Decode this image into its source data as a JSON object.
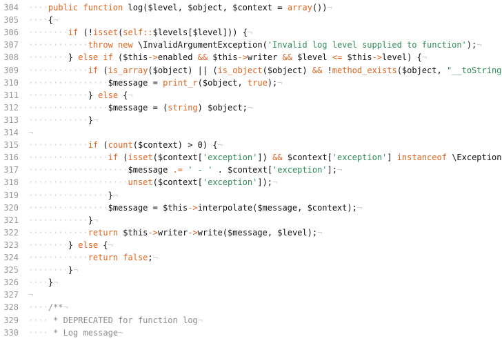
{
  "editor": {
    "colors": {
      "keyword": "#e0631e",
      "string": "#2e8b57",
      "comment": "#8c8c8c",
      "whitespace": "#d0d0d0",
      "line_number": "#999999",
      "text": "#111111"
    },
    "lines": [
      {
        "n": "304",
        "tokens": [
          {
            "t": "ws",
            "v": "····"
          },
          {
            "t": "kw",
            "v": "public function "
          },
          {
            "t": "plain",
            "v": "log($level, $object, $context = "
          },
          {
            "t": "kw",
            "v": "array"
          },
          {
            "t": "plain",
            "v": "())"
          },
          {
            "t": "eol",
            "v": "¬"
          }
        ]
      },
      {
        "n": "305",
        "tokens": [
          {
            "t": "ws",
            "v": "····"
          },
          {
            "t": "plain",
            "v": "{"
          },
          {
            "t": "eol",
            "v": "¬"
          }
        ]
      },
      {
        "n": "306",
        "tokens": [
          {
            "t": "ws",
            "v": "········"
          },
          {
            "t": "kw",
            "v": "if "
          },
          {
            "t": "plain",
            "v": "(!"
          },
          {
            "t": "kw",
            "v": "isset"
          },
          {
            "t": "plain",
            "v": "("
          },
          {
            "t": "kw",
            "v": "self::"
          },
          {
            "t": "plain",
            "v": "$levels[$level])) {"
          },
          {
            "t": "eol",
            "v": "¬"
          }
        ]
      },
      {
        "n": "307",
        "tokens": [
          {
            "t": "ws",
            "v": "············"
          },
          {
            "t": "kw",
            "v": "throw new "
          },
          {
            "t": "plain",
            "v": "\\InvalidArgumentException("
          },
          {
            "t": "str",
            "v": "'Invalid log level supplied to function'"
          },
          {
            "t": "plain",
            "v": ");"
          },
          {
            "t": "eol",
            "v": "¬"
          }
        ]
      },
      {
        "n": "308",
        "tokens": [
          {
            "t": "ws",
            "v": "········"
          },
          {
            "t": "plain",
            "v": "} "
          },
          {
            "t": "kw",
            "v": "else if "
          },
          {
            "t": "plain",
            "v": "($this"
          },
          {
            "t": "op",
            "v": "->"
          },
          {
            "t": "plain",
            "v": "enabled "
          },
          {
            "t": "op",
            "v": "&&"
          },
          {
            "t": "plain",
            "v": " $this"
          },
          {
            "t": "op",
            "v": "->"
          },
          {
            "t": "plain",
            "v": "writer "
          },
          {
            "t": "op",
            "v": "&&"
          },
          {
            "t": "plain",
            "v": " $level "
          },
          {
            "t": "op",
            "v": "<="
          },
          {
            "t": "plain",
            "v": " $this"
          },
          {
            "t": "op",
            "v": "->"
          },
          {
            "t": "plain",
            "v": "level) {"
          },
          {
            "t": "eol",
            "v": "¬"
          }
        ]
      },
      {
        "n": "309",
        "tokens": [
          {
            "t": "ws",
            "v": "············"
          },
          {
            "t": "kw",
            "v": "if "
          },
          {
            "t": "plain",
            "v": "("
          },
          {
            "t": "kw",
            "v": "is_array"
          },
          {
            "t": "plain",
            "v": "($object) || ("
          },
          {
            "t": "kw",
            "v": "is_object"
          },
          {
            "t": "plain",
            "v": "($object) "
          },
          {
            "t": "op",
            "v": "&&"
          },
          {
            "t": "plain",
            "v": " !"
          },
          {
            "t": "kw",
            "v": "method_exists"
          },
          {
            "t": "plain",
            "v": "($object, "
          },
          {
            "t": "str",
            "v": "\"__toString\""
          },
          {
            "t": "plain",
            "v": "))"
          }
        ]
      },
      {
        "n": "310",
        "tokens": [
          {
            "t": "ws",
            "v": "················"
          },
          {
            "t": "plain",
            "v": "$message = "
          },
          {
            "t": "kw",
            "v": "print_r"
          },
          {
            "t": "plain",
            "v": "($object, "
          },
          {
            "t": "kw",
            "v": "true"
          },
          {
            "t": "plain",
            "v": ");"
          },
          {
            "t": "eol",
            "v": "¬"
          }
        ]
      },
      {
        "n": "311",
        "tokens": [
          {
            "t": "ws",
            "v": "············"
          },
          {
            "t": "plain",
            "v": "} "
          },
          {
            "t": "kw",
            "v": "else "
          },
          {
            "t": "plain",
            "v": "{"
          },
          {
            "t": "eol",
            "v": "¬"
          }
        ]
      },
      {
        "n": "312",
        "tokens": [
          {
            "t": "ws",
            "v": "················"
          },
          {
            "t": "plain",
            "v": "$message = ("
          },
          {
            "t": "kw",
            "v": "string"
          },
          {
            "t": "plain",
            "v": ") $object;"
          },
          {
            "t": "eol",
            "v": "¬"
          }
        ]
      },
      {
        "n": "313",
        "tokens": [
          {
            "t": "ws",
            "v": "············"
          },
          {
            "t": "plain",
            "v": "}"
          },
          {
            "t": "eol",
            "v": "¬"
          }
        ]
      },
      {
        "n": "314",
        "tokens": [
          {
            "t": "eol",
            "v": "¬"
          }
        ]
      },
      {
        "n": "315",
        "tokens": [
          {
            "t": "ws",
            "v": "············"
          },
          {
            "t": "kw",
            "v": "if "
          },
          {
            "t": "plain",
            "v": "("
          },
          {
            "t": "kw",
            "v": "count"
          },
          {
            "t": "plain",
            "v": "($context) > 0) {"
          },
          {
            "t": "eol",
            "v": "¬"
          }
        ]
      },
      {
        "n": "316",
        "tokens": [
          {
            "t": "ws",
            "v": "················"
          },
          {
            "t": "kw",
            "v": "if "
          },
          {
            "t": "plain",
            "v": "("
          },
          {
            "t": "kw",
            "v": "isset"
          },
          {
            "t": "plain",
            "v": "($context["
          },
          {
            "t": "str",
            "v": "'exception'"
          },
          {
            "t": "plain",
            "v": "]) "
          },
          {
            "t": "op",
            "v": "&&"
          },
          {
            "t": "plain",
            "v": " $context["
          },
          {
            "t": "str",
            "v": "'exception'"
          },
          {
            "t": "plain",
            "v": "] "
          },
          {
            "t": "kw",
            "v": "instanceof "
          },
          {
            "t": "plain",
            "v": "\\Exception) {"
          }
        ]
      },
      {
        "n": "317",
        "tokens": [
          {
            "t": "ws",
            "v": "····················"
          },
          {
            "t": "plain",
            "v": "$message "
          },
          {
            "t": "op",
            "v": ".="
          },
          {
            "t": "plain",
            "v": " "
          },
          {
            "t": "str",
            "v": "' - '"
          },
          {
            "t": "plain",
            "v": " . $context["
          },
          {
            "t": "str",
            "v": "'exception'"
          },
          {
            "t": "plain",
            "v": "];"
          },
          {
            "t": "eol",
            "v": "¬"
          }
        ]
      },
      {
        "n": "318",
        "tokens": [
          {
            "t": "ws",
            "v": "····················"
          },
          {
            "t": "kw",
            "v": "unset"
          },
          {
            "t": "plain",
            "v": "($context["
          },
          {
            "t": "str",
            "v": "'exception'"
          },
          {
            "t": "plain",
            "v": "]);"
          },
          {
            "t": "eol",
            "v": "¬"
          }
        ]
      },
      {
        "n": "319",
        "tokens": [
          {
            "t": "ws",
            "v": "················"
          },
          {
            "t": "plain",
            "v": "}"
          },
          {
            "t": "eol",
            "v": "¬"
          }
        ]
      },
      {
        "n": "320",
        "tokens": [
          {
            "t": "ws",
            "v": "················"
          },
          {
            "t": "plain",
            "v": "$message = $this"
          },
          {
            "t": "op",
            "v": "->"
          },
          {
            "t": "plain",
            "v": "interpolate($message, $context);"
          },
          {
            "t": "eol",
            "v": "¬"
          }
        ]
      },
      {
        "n": "321",
        "tokens": [
          {
            "t": "ws",
            "v": "············"
          },
          {
            "t": "plain",
            "v": "}"
          },
          {
            "t": "eol",
            "v": "¬"
          }
        ]
      },
      {
        "n": "322",
        "tokens": [
          {
            "t": "ws",
            "v": "············"
          },
          {
            "t": "kw",
            "v": "return "
          },
          {
            "t": "plain",
            "v": "$this"
          },
          {
            "t": "op",
            "v": "->"
          },
          {
            "t": "plain",
            "v": "writer"
          },
          {
            "t": "op",
            "v": "->"
          },
          {
            "t": "plain",
            "v": "write($message, $level);"
          },
          {
            "t": "eol",
            "v": "¬"
          }
        ]
      },
      {
        "n": "323",
        "tokens": [
          {
            "t": "ws",
            "v": "········"
          },
          {
            "t": "plain",
            "v": "} "
          },
          {
            "t": "kw",
            "v": "else "
          },
          {
            "t": "plain",
            "v": "{"
          },
          {
            "t": "eol",
            "v": "¬"
          }
        ]
      },
      {
        "n": "324",
        "tokens": [
          {
            "t": "ws",
            "v": "············"
          },
          {
            "t": "kw",
            "v": "return false"
          },
          {
            "t": "plain",
            "v": ";"
          },
          {
            "t": "eol",
            "v": "¬"
          }
        ]
      },
      {
        "n": "325",
        "tokens": [
          {
            "t": "ws",
            "v": "········"
          },
          {
            "t": "plain",
            "v": "}"
          },
          {
            "t": "eol",
            "v": "¬"
          }
        ]
      },
      {
        "n": "326",
        "tokens": [
          {
            "t": "ws",
            "v": "····"
          },
          {
            "t": "plain",
            "v": "}"
          },
          {
            "t": "eol",
            "v": "¬"
          }
        ]
      },
      {
        "n": "327",
        "tokens": [
          {
            "t": "eol",
            "v": "¬"
          }
        ]
      },
      {
        "n": "328",
        "tokens": [
          {
            "t": "ws",
            "v": "····"
          },
          {
            "t": "cmt",
            "v": "/**"
          },
          {
            "t": "eol",
            "v": "¬"
          }
        ]
      },
      {
        "n": "329",
        "tokens": [
          {
            "t": "ws",
            "v": "····"
          },
          {
            "t": "cmt",
            "v": " * DEPRECATED for function log"
          },
          {
            "t": "eol",
            "v": "¬"
          }
        ]
      },
      {
        "n": "330",
        "tokens": [
          {
            "t": "ws",
            "v": "····"
          },
          {
            "t": "cmt",
            "v": " * Log message"
          },
          {
            "t": "eol",
            "v": "¬"
          }
        ]
      }
    ]
  }
}
